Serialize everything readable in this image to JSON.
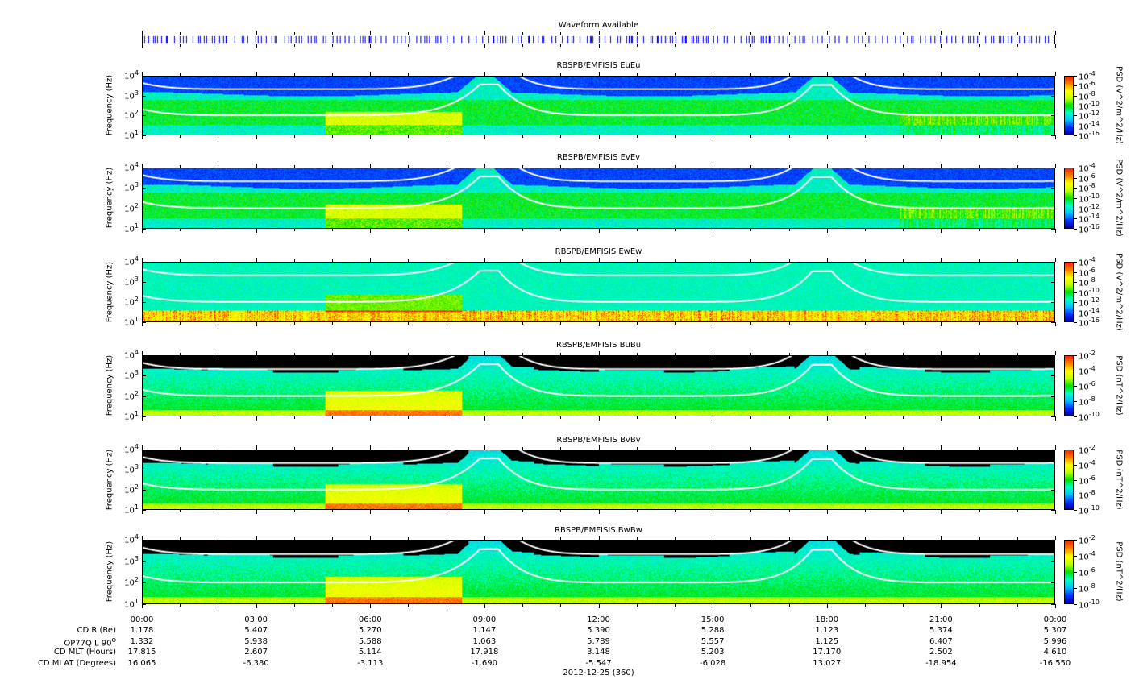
{
  "waveform": {
    "title": "Waveform Available",
    "color": "#0000ff"
  },
  "chart_data": [
    {
      "type": "heatmap",
      "title": "RBSPB/EMFISIS  EuEu",
      "ylabel": "Frequency (Hz)",
      "yscale": "log",
      "ylim": [
        10,
        10000
      ],
      "yticks": [
        "10",
        "10",
        "10",
        "10"
      ],
      "yexp": [
        "1",
        "2",
        "3",
        "4"
      ],
      "cbar_label": "PSD (V^2/m^2/Hz)",
      "cbar_ticks": [
        "-4",
        "-6",
        "-8",
        "-10",
        "-12",
        "-14",
        "-16"
      ],
      "kind": "E"
    },
    {
      "type": "heatmap",
      "title": "RBSPB/EMFISIS  EvEv",
      "ylabel": "Frequency (Hz)",
      "yscale": "log",
      "ylim": [
        10,
        10000
      ],
      "yticks": [
        "10",
        "10",
        "10",
        "10"
      ],
      "yexp": [
        "1",
        "2",
        "3",
        "4"
      ],
      "cbar_label": "PSD (V^2/m^2/Hz)",
      "cbar_ticks": [
        "-4",
        "-6",
        "-8",
        "-10",
        "-12",
        "-14",
        "-16"
      ],
      "kind": "E"
    },
    {
      "type": "heatmap",
      "title": "RBSPB/EMFISIS  EwEw",
      "ylabel": "Frequency (Hz)",
      "yscale": "log",
      "ylim": [
        10,
        10000
      ],
      "yticks": [
        "10",
        "10",
        "10",
        "10"
      ],
      "yexp": [
        "1",
        "2",
        "3",
        "4"
      ],
      "cbar_label": "PSD (V^2/m^2/Hz)",
      "cbar_ticks": [
        "-4",
        "-6",
        "-8",
        "-10",
        "-12",
        "-14",
        "-16"
      ],
      "kind": "Ew"
    },
    {
      "type": "heatmap",
      "title": "RBSPB/EMFISIS  BuBu",
      "ylabel": "Frequency (Hz)",
      "yscale": "log",
      "ylim": [
        10,
        10000
      ],
      "yticks": [
        "10",
        "10",
        "10",
        "10"
      ],
      "yexp": [
        "1",
        "2",
        "3",
        "4"
      ],
      "cbar_label": "PSD (nT^2/Hz)",
      "cbar_ticks": [
        "-2",
        "-4",
        "-6",
        "-8",
        "-10"
      ],
      "kind": "B"
    },
    {
      "type": "heatmap",
      "title": "RBSPB/EMFISIS  BvBv",
      "ylabel": "Frequency (Hz)",
      "yscale": "log",
      "ylim": [
        10,
        10000
      ],
      "yticks": [
        "10",
        "10",
        "10",
        "10"
      ],
      "yexp": [
        "1",
        "2",
        "3",
        "4"
      ],
      "cbar_label": "PSD (nT^2/Hz)",
      "cbar_ticks": [
        "-2",
        "-4",
        "-6",
        "-8",
        "-10"
      ],
      "kind": "B"
    },
    {
      "type": "heatmap",
      "title": "RBSPB/EMFISIS  BwBw",
      "ylabel": "Frequency (Hz)",
      "yscale": "log",
      "ylim": [
        10,
        10000
      ],
      "yticks": [
        "10",
        "10",
        "10",
        "10"
      ],
      "yexp": [
        "1",
        "2",
        "3",
        "4"
      ],
      "cbar_label": "PSD (nT^2/Hz)",
      "cbar_ticks": [
        "-2",
        "-4",
        "-6",
        "-8",
        "-10"
      ],
      "kind": "B"
    }
  ],
  "xaxis": {
    "ticks": [
      "00:00",
      "03:00",
      "06:00",
      "09:00",
      "12:00",
      "15:00",
      "18:00",
      "21:00",
      "00:00"
    ],
    "date": "2012-12-25 (360)"
  },
  "ephemeris": [
    {
      "label": "CD R (Re)",
      "values": [
        "1.178",
        "5.407",
        "5.270",
        "1.147",
        "5.390",
        "5.288",
        "1.123",
        "5.374",
        "5.307"
      ]
    },
    {
      "label": "OP77Q L 90",
      "sup": "O",
      "values": [
        "1.332",
        "5.938",
        "5.588",
        "1.063",
        "5.789",
        "5.557",
        "1.125",
        "6.407",
        "5.996"
      ]
    },
    {
      "label": "CD MLT (Hours)",
      "values": [
        "17.815",
        "2.607",
        "5.114",
        "17.918",
        "3.148",
        "5.203",
        "17.170",
        "2.502",
        "4.610"
      ]
    },
    {
      "label": "CD MLAT (Degrees)",
      "values": [
        "16.065",
        "-6.380",
        "-3.113",
        "-1.690",
        "-5.547",
        "-6.028",
        "13.027",
        "-18.954",
        "-16.550"
      ]
    }
  ]
}
